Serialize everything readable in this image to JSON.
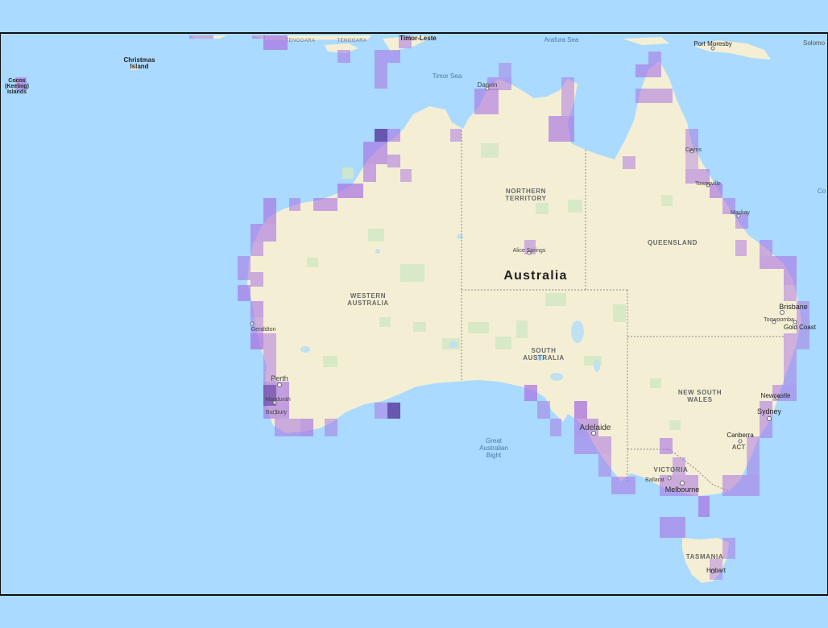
{
  "map": {
    "colors": {
      "ocean": "#aadaff",
      "land": "#f4efd4",
      "park": "#d3e8c4",
      "lake": "#bfe1f2",
      "border": "#888888",
      "cell_light": "#c99be9",
      "cell_medium": "#a872e2",
      "cell_dark": "#5d3fa0"
    },
    "labels": {
      "country": "Australia",
      "wa": [
        "WESTERN",
        "AUSTRALIA"
      ],
      "nt": [
        "NORTHERN",
        "TERRITORY"
      ],
      "sa": [
        "SOUTH",
        "AUSTRALIA"
      ],
      "qld": "QUEENSLAND",
      "nsw": [
        "NEW SOUTH",
        "WALES"
      ],
      "vic": "VICTORIA",
      "tas": "TASMANIA",
      "act": "ACT",
      "christmas": [
        "Christmas",
        "Island"
      ],
      "cocos": [
        "Cocos",
        "(Keeling)",
        "Islands"
      ],
      "timor_sea": "Timor Sea",
      "arafura_sea": "Arafura Sea",
      "bight": [
        "Great",
        "Australian",
        "Bight"
      ],
      "tenggara_1": "TENGGARA",
      "tenggara_2": "TENGGARA",
      "timor_leste": "Timor-Leste",
      "port_moresby": "Port Moresby",
      "solomon": "Solomo",
      "coral_edge": "Co",
      "darwin": "Darwin",
      "cairns": "Cairns",
      "townsville": "Townsville",
      "mackay": "Mackay",
      "alice_springs": "Alice Springs",
      "brisbane": "Brisbane",
      "toowoomba": "Toowoomba",
      "gold_coast": "Gold Coast",
      "geraldton": "Geraldton",
      "perth": "Perth",
      "mandurah": "Mandurah",
      "bunbury": "Bunbury",
      "adelaide": "Adelaide",
      "newcastle": "Newcastle",
      "sydney": "Sydney",
      "canberra": "Canberra",
      "ballarat": "Ballarat",
      "melbourne": "Melbourne",
      "hobart": "Hobart"
    },
    "occurrence_cells": [
      [
        "Cocos (Keeling) Islands",
        0.4
      ],
      [
        "Timor-Leste coast",
        0.5
      ],
      [
        "Tenggara islands",
        0.5
      ],
      [
        "Top End (Darwin)",
        0.6
      ],
      [
        "Gulf of Carpentaria",
        0.6
      ],
      [
        "Torres Strait",
        0.6
      ],
      [
        "Kimberley coast",
        0.85
      ],
      [
        "Broome coast",
        0.6
      ],
      [
        "Pilbara coast",
        0.6
      ],
      [
        "Shark Bay",
        0.6
      ],
      [
        "Geraldton coast",
        0.6
      ],
      [
        "Perth coast",
        0.75
      ],
      [
        "South-west WA",
        0.5
      ],
      [
        "Great Australian Bight east",
        0.85
      ],
      [
        "Eyre Peninsula",
        0.6
      ],
      [
        "Adelaide coast",
        0.6
      ],
      [
        "Melbourne coast",
        0.55
      ],
      [
        "Bass Strait",
        0.5
      ],
      [
        "Tasmania east coast",
        0.45
      ],
      [
        "NSW coast",
        0.5
      ],
      [
        "Brisbane coast",
        0.6
      ],
      [
        "Great Barrier Reef",
        0.5
      ],
      [
        "Alice Springs",
        0.4
      ]
    ]
  }
}
